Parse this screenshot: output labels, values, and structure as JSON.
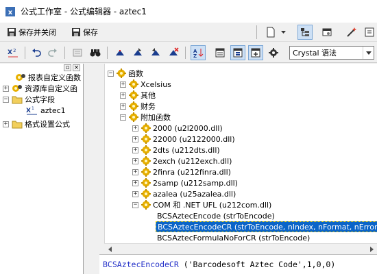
{
  "window": {
    "title": "公式工作室 - 公式编辑器 - aztec1"
  },
  "toolbar1": {
    "save_close_label": "保存并关闭",
    "save_label": "保存"
  },
  "toolbar2": {
    "syntax_combo_value": "Crystal 语法"
  },
  "left_tree": {
    "items": [
      {
        "label": "报表自定义函数"
      },
      {
        "label": "资源库自定义函"
      },
      {
        "label": "公式字段"
      },
      {
        "label": "aztec1"
      },
      {
        "label": "格式设置公式"
      }
    ]
  },
  "function_tree": {
    "root": "函数",
    "categories": [
      "Xcelsius",
      "其他",
      "财务",
      "附加函数"
    ],
    "addins": [
      "2000 (u2l2000.dll)",
      "22000 (u2122000.dll)",
      "2dts (u212dts.dll)",
      "2exch (u212exch.dll)",
      "2finra (u212finra.dll)",
      "2samp (u212samp.dll)",
      "azalea (u25azalea.dll)",
      "COM 和 .NET UFL (u212com.dll)"
    ],
    "functions": [
      "BCSAztecEncode (strToEncode)",
      "BCSAztecEncodeCR (strToEncode, nIndex, nFormat, nErrorLevel)",
      "BCSAztecFormulaNoForCR (strToEncode)"
    ]
  },
  "editor": {
    "function_name": "BCSAztecEncodeCR",
    "arguments": " ('Barcodesoft Aztec Code',1,0,0)"
  }
}
